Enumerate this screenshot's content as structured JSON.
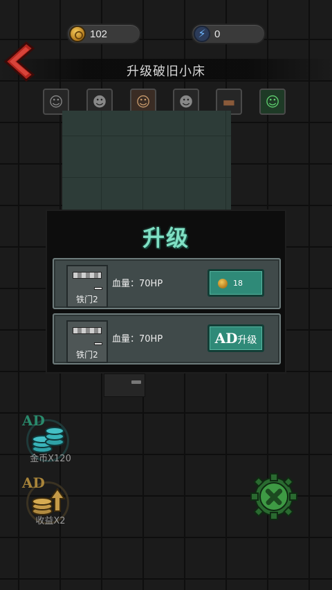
{
  "resources": {
    "coins": "102",
    "energy": "0",
    "coin_icon": "coin-icon",
    "energy_icon": "lightning-icon"
  },
  "header": {
    "title": "升级破旧小床",
    "back_icon": "back-arrow-icon"
  },
  "characters": [
    {
      "icon": "character-1-icon"
    },
    {
      "icon": "character-2-icon"
    },
    {
      "icon": "character-3-icon"
    },
    {
      "icon": "character-4-icon"
    },
    {
      "icon": "character-5-icon"
    },
    {
      "icon": "character-6-icon"
    }
  ],
  "modal": {
    "title": "升级",
    "options": [
      {
        "item_label": "铁门2",
        "hp_text": "血量：70HP",
        "cost": "18",
        "button_type": "coin"
      },
      {
        "item_label": "铁门2",
        "hp_text": "血量：70HP",
        "ad_label": "AD",
        "button_text": "升级",
        "button_type": "ad"
      }
    ]
  },
  "bonuses": [
    {
      "ad_label": "AD",
      "label": "金币X120",
      "icon": "coin-stack-icon"
    },
    {
      "ad_label": "AD",
      "label": "收益X2",
      "icon": "income-boost-icon"
    }
  ],
  "settings": {
    "icon": "wrench-gear-icon"
  },
  "colors": {
    "accent": "#2f8a78",
    "title_green": "#7fe0c4",
    "coin_gold": "#d8a23a",
    "back_red": "#b3261e"
  }
}
